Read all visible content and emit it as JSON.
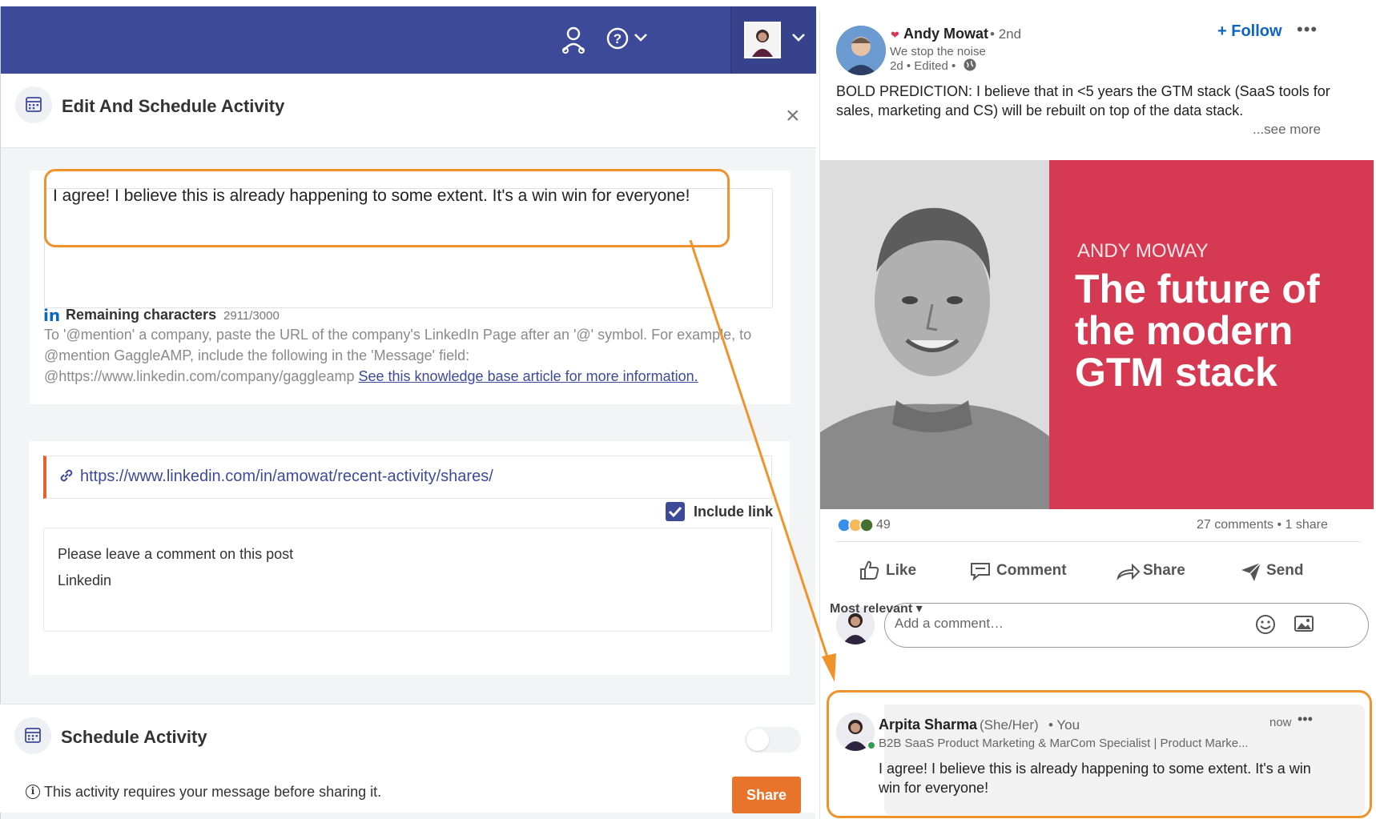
{
  "left_panel": {
    "edit_header": {
      "title": "Edit And Schedule Activity"
    },
    "message": {
      "text": "I agree! I believe this is already happening to some extent. It's a win win for everyone!"
    },
    "remaining": {
      "label": "Remaining characters",
      "count": "2911/3000"
    },
    "help_text": {
      "line1": "To '@mention' a company, paste the URL of the company's LinkedIn Page after an '@' symbol. For example, to",
      "line2": "@mention GaggleAMP, include the following in the 'Message' field:",
      "line3_prefix": "@https://www.linkedin.com/company/gaggleamp ",
      "link_text": "See this knowledge base article for more information."
    },
    "link": {
      "url": "https://www.linkedin.com/in/amowat/recent-activity/shares/"
    },
    "include_link": {
      "label": "Include link",
      "checked": true
    },
    "instructions": {
      "line1": "Please leave a comment on this post",
      "line2": "Linkedin"
    },
    "schedule": {
      "title": "Schedule Activity",
      "enabled": false
    },
    "footer": {
      "message": "This activity requires your message before sharing it.",
      "share_label": "Share"
    },
    "colors": {
      "topbar": "#3d4a9a",
      "accent": "#e8732a",
      "highlight": "#f0932b"
    }
  },
  "right_panel": {
    "post": {
      "author_name": "Andy Mowat",
      "degree": "2nd",
      "tagline": "We stop the noise",
      "meta": "2d • Edited •",
      "follow_label": "Follow",
      "text_line1": "BOLD PREDICTION: I believe that in <5 years the GTM stack (SaaS tools for",
      "text_line2": "sales, marketing and CS) will be rebuilt on top of the data stack.",
      "see_more": "...see more",
      "banner": {
        "name": "ANDY MOWAY",
        "headline_line1": "The future of",
        "headline_line2": "the modern",
        "headline_line3": "GTM stack"
      },
      "reactions_count": "49",
      "stats": "27 comments • 1 share"
    },
    "actions": {
      "like": "Like",
      "comment": "Comment",
      "share": "Share",
      "send": "Send"
    },
    "comment_input": {
      "placeholder": "Add a comment…"
    },
    "sort": {
      "label": "Most relevant"
    },
    "my_comment": {
      "name": "Arpita Sharma",
      "pronouns": "(She/Her)",
      "relation": "• You",
      "headline": "B2B SaaS Product Marketing & MarCom Specialist | Product Marke...",
      "time": "now",
      "text_line1": "I agree! I believe this is already happening to some extent. It's a win",
      "text_line2": "win for everyone!"
    },
    "colors": {
      "linkedin_blue": "#0a66c2",
      "banner_red": "#d53a52"
    }
  }
}
